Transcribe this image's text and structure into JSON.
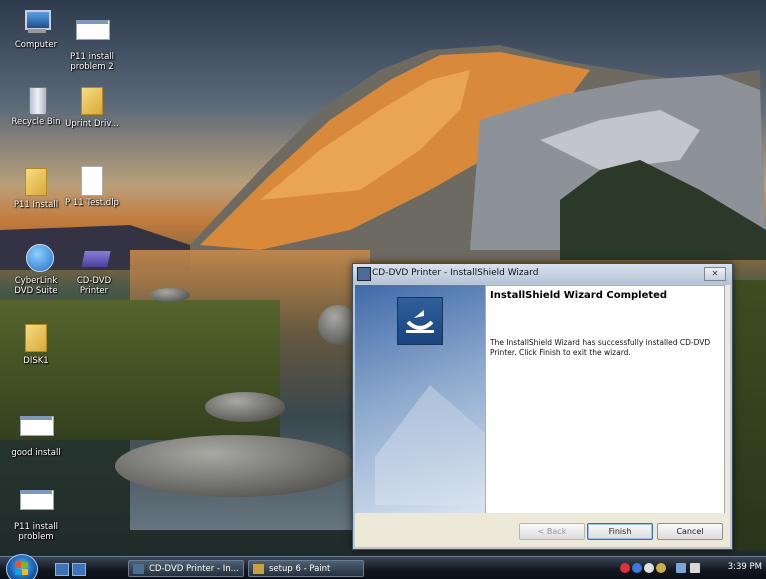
{
  "desktop": {
    "icons": [
      {
        "label": "Computer"
      },
      {
        "label": "P11 install problem 2"
      },
      {
        "label": "Recycle Bin"
      },
      {
        "label": "Uprint Driv..."
      },
      {
        "label": "P11 Install"
      },
      {
        "label": "P 11 Test.dlp"
      },
      {
        "label": "CyberLink DVD Suite"
      },
      {
        "label": "CD-DVD Printer"
      },
      {
        "label": "DISK1"
      },
      {
        "label": "good install"
      },
      {
        "label": "P11 install problem"
      }
    ]
  },
  "dialog": {
    "title": "CD-DVD Printer - InstallShield Wizard",
    "heading": "InstallShield Wizard Completed",
    "body": "The InstallShield Wizard has successfully installed CD-DVD Printer. Click Finish to exit the wizard.",
    "back_label": "< Back",
    "finish_label": "Finish",
    "cancel_label": "Cancel",
    "close_label": "✕"
  },
  "taskbar": {
    "buttons": [
      {
        "label": "CD-DVD Printer - In..."
      },
      {
        "label": "setup 6 - Paint"
      }
    ],
    "clock": "3:39 PM"
  }
}
